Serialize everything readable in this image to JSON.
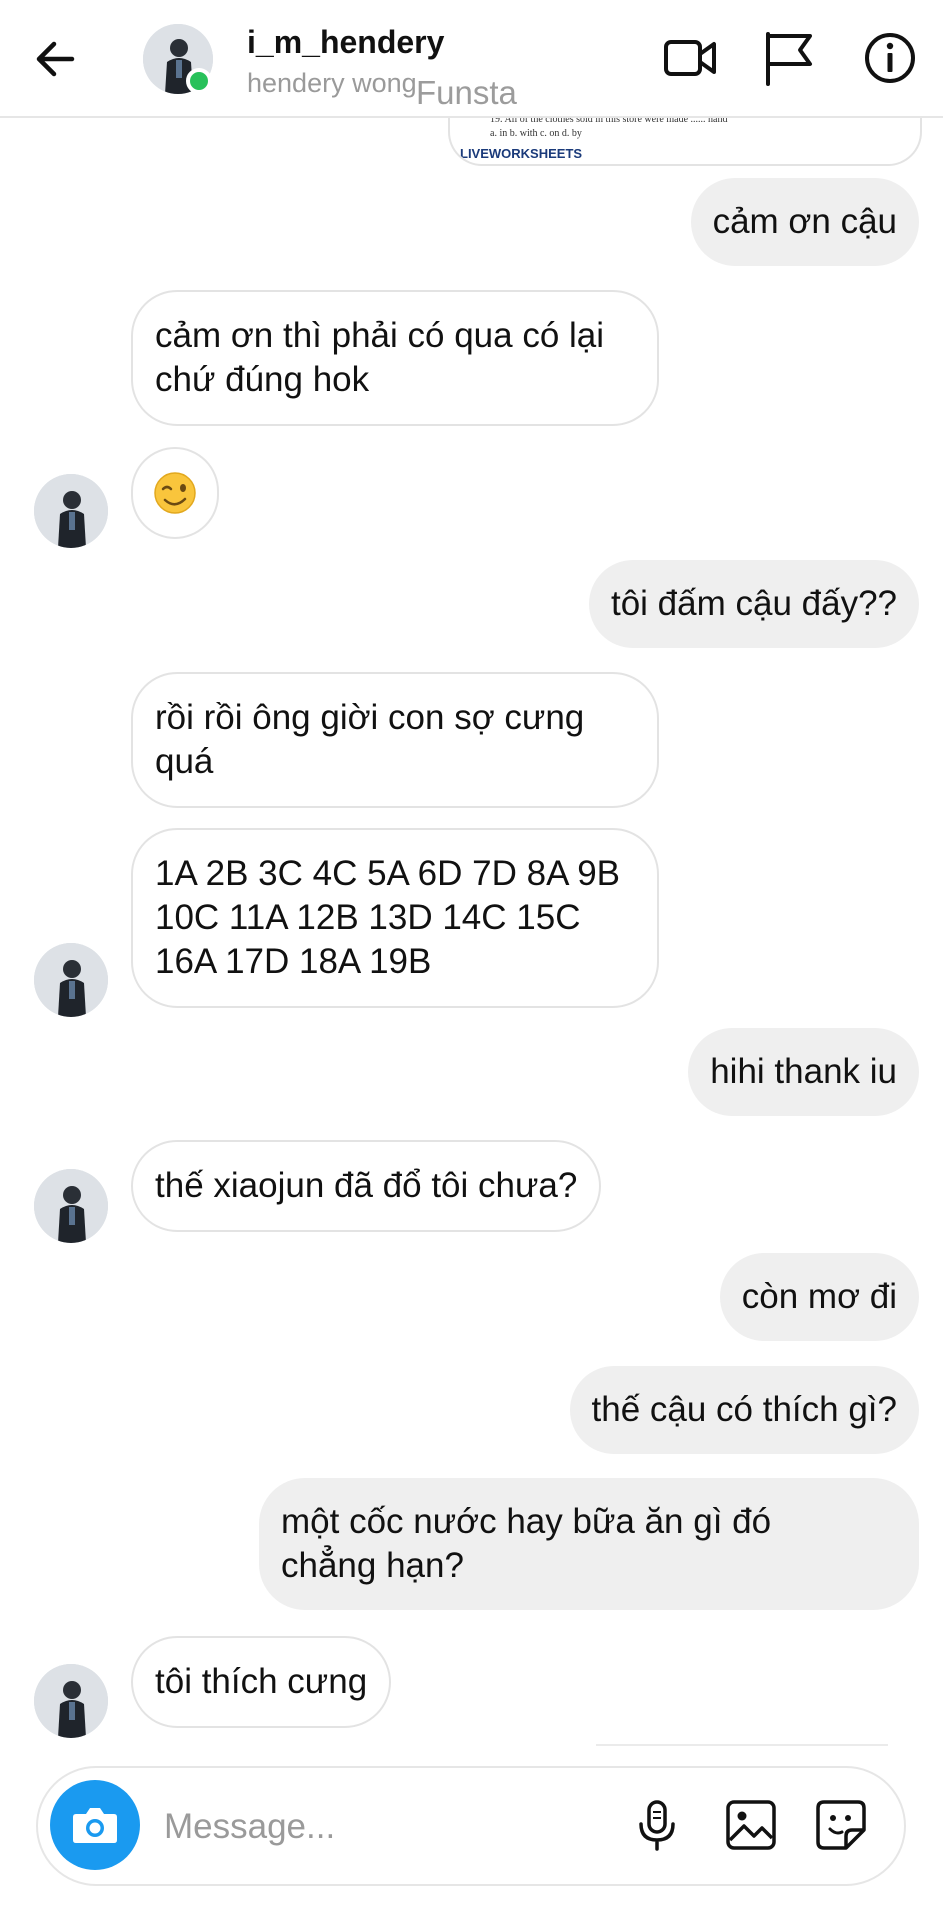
{
  "header": {
    "username": "i_m_hendery",
    "fullname": "hendery wong",
    "watermark": "Funsta",
    "icons": [
      "back-arrow-icon",
      "video-call-icon",
      "flag-icon",
      "info-icon"
    ],
    "online_color": "#28c15a"
  },
  "shared_image": {
    "lines": [
      "19. All of the clothes sold in this store were made ...... hand",
      "a. in          b. with          c. on          d. by"
    ],
    "brand": "LIVEWORKSHEETS"
  },
  "messages": [
    {
      "side": "out",
      "text": "cảm ơn cậu"
    },
    {
      "side": "in",
      "text": "cảm ơn thì phải có qua có lại\nchứ đúng hok"
    },
    {
      "side": "in",
      "emoji": "winking-face"
    },
    {
      "side": "out",
      "text": "tôi đấm cậu đấy??"
    },
    {
      "side": "in",
      "text": "rồi rồi ông giời con sợ cưng\nquá"
    },
    {
      "side": "in",
      "text": "1A 2B 3C 4C 5A 6D 7D 8A 9B\n10C 11A 12B 13D 14C 15C\n16A 17D 18A 19B"
    },
    {
      "side": "out",
      "text": "hihi thank iu"
    },
    {
      "side": "in",
      "text": "thế xiaojun đã đổ tôi chưa?"
    },
    {
      "side": "out",
      "text": "còn mơ đi"
    },
    {
      "side": "out",
      "text": "thế cậu có thích gì?"
    },
    {
      "side": "out",
      "text": "một cốc nước hay bữa ăn gì đó\nchẳng hạn?"
    },
    {
      "side": "in",
      "text": "tôi thích cưng"
    }
  ],
  "composer": {
    "placeholder": "Message...",
    "icons": [
      "camera-icon",
      "microphone-icon",
      "gallery-icon",
      "sticker-icon"
    ],
    "accent": "#1a9af0"
  },
  "colors": {
    "incoming_bg": "#ffffff",
    "outgoing_bg": "#efefef",
    "border": "#e3e3e3"
  }
}
